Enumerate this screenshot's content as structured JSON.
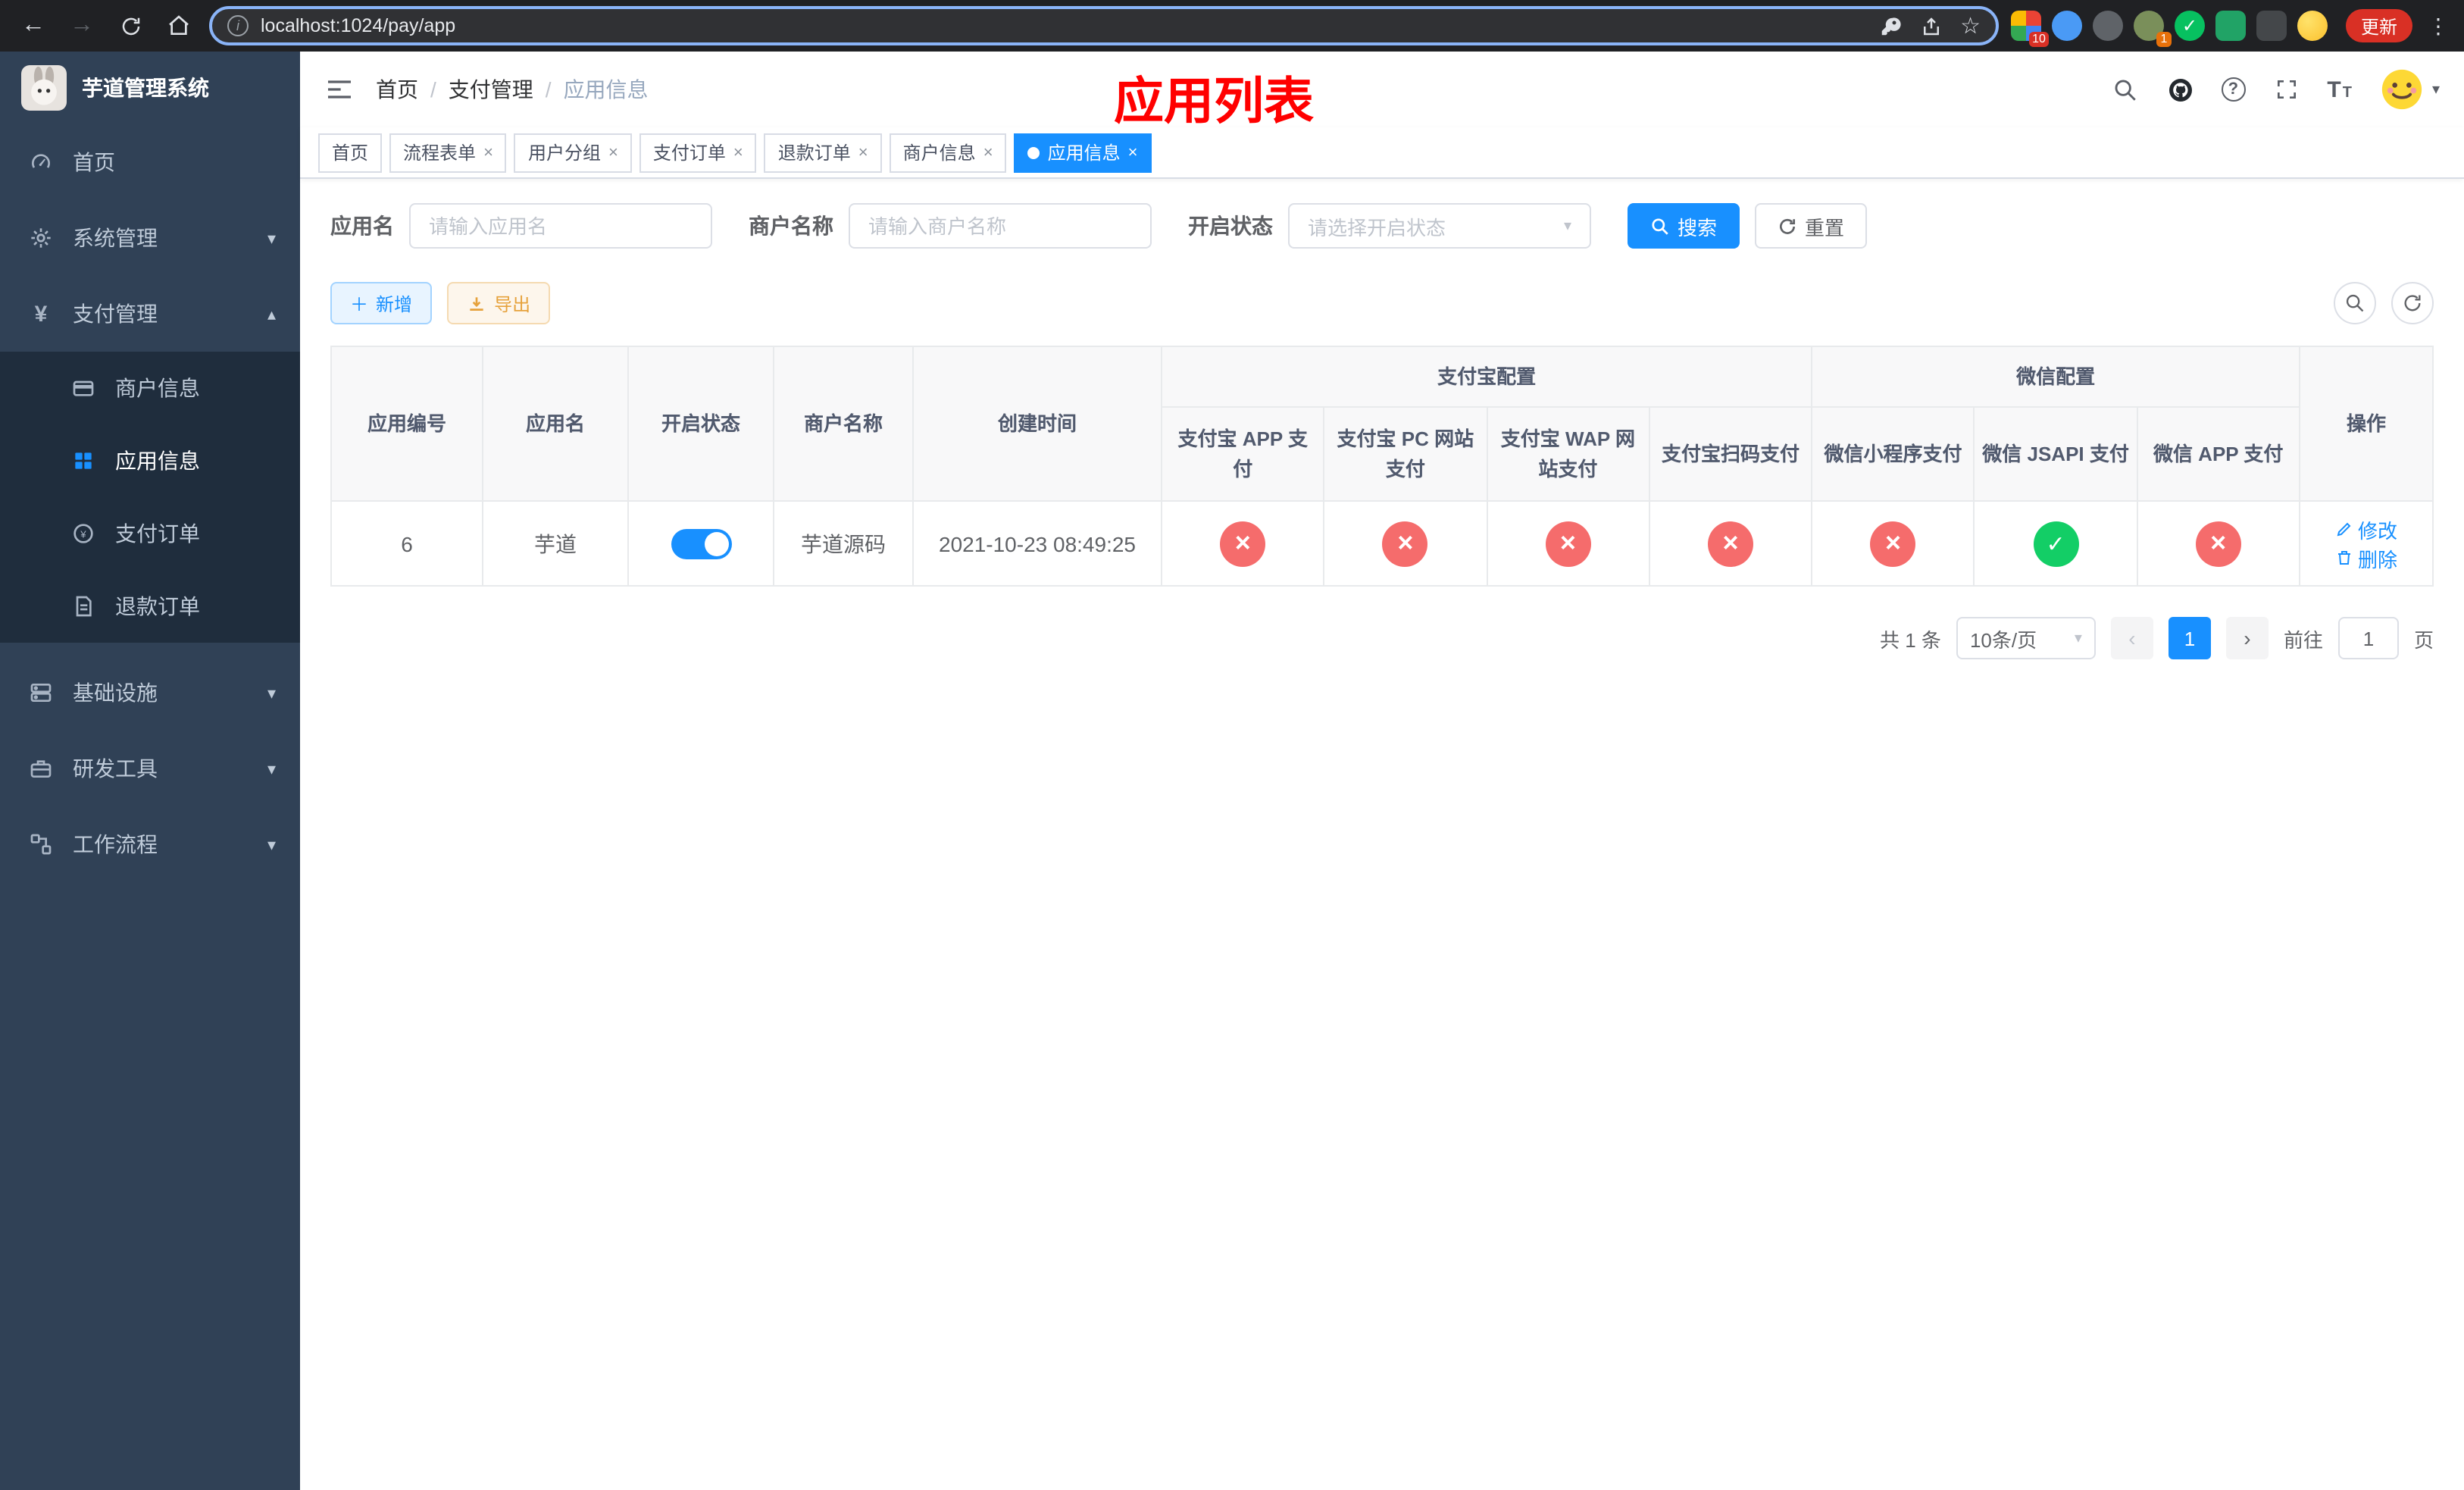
{
  "browser": {
    "url": "localhost:1024/pay/app",
    "update_label": "更新",
    "extensions_badge": "10",
    "avatar_badge": "1"
  },
  "sidebar": {
    "title": "芋道管理系统",
    "menu": [
      {
        "label": "首页"
      },
      {
        "label": "系统管理"
      },
      {
        "label": "支付管理"
      },
      {
        "label": "基础设施"
      },
      {
        "label": "研发工具"
      },
      {
        "label": "工作流程"
      }
    ],
    "submenu": [
      {
        "label": "商户信息"
      },
      {
        "label": "应用信息"
      },
      {
        "label": "支付订单"
      },
      {
        "label": "退款订单"
      }
    ]
  },
  "header": {
    "breadcrumb": [
      "首页",
      "支付管理",
      "应用信息"
    ],
    "annotation": "应用列表"
  },
  "tabs": [
    {
      "label": "首页"
    },
    {
      "label": "流程表单"
    },
    {
      "label": "用户分组"
    },
    {
      "label": "支付订单"
    },
    {
      "label": "退款订单"
    },
    {
      "label": "商户信息"
    },
    {
      "label": "应用信息"
    }
  ],
  "filters": {
    "app_name_label": "应用名",
    "app_name_placeholder": "请输入应用名",
    "merchant_label": "商户名称",
    "merchant_placeholder": "请输入商户名称",
    "status_label": "开启状态",
    "status_placeholder": "请选择开启状态",
    "search_label": "搜索",
    "reset_label": "重置"
  },
  "toolbar": {
    "add_label": "新增",
    "export_label": "导出"
  },
  "table": {
    "headers": {
      "app_id": "应用编号",
      "app_name": "应用名",
      "status": "开启状态",
      "merchant": "商户名称",
      "created": "创建时间",
      "alipay_group": "支付宝配置",
      "alipay_app": "支付宝 APP 支付",
      "alipay_pc": "支付宝 PC 网站支付",
      "alipay_wap": "支付宝 WAP 网站支付",
      "alipay_qr": "支付宝扫码支付",
      "wechat_group": "微信配置",
      "wechat_mini": "微信小程序支付",
      "wechat_jsapi": "微信 JSAPI 支付",
      "wechat_app": "微信 APP 支付",
      "actions": "操作"
    },
    "rows": [
      {
        "app_id": "6",
        "app_name": "芋道",
        "status": "on",
        "merchant": "芋道源码",
        "created": "2021-10-23 08:49:25",
        "alipay_app": "disabled",
        "alipay_pc": "disabled",
        "alipay_wap": "disabled",
        "alipay_qr": "disabled",
        "wechat_mini": "disabled",
        "wechat_jsapi": "enabled",
        "wechat_app": "disabled",
        "edit_label": "修改",
        "delete_label": "删除"
      }
    ]
  },
  "pagination": {
    "total": "共 1 条",
    "page_size": "10条/页",
    "current_page": "1",
    "goto_label": "前往",
    "goto_value": "1",
    "page_suffix": "页"
  }
}
